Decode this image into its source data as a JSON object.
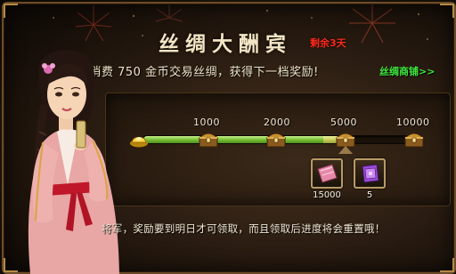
{
  "event": {
    "title": "丝绸大酬宾",
    "days_left": "剩余3天"
  },
  "description": {
    "text": "再消费 750 金币交易丝绸，获得下一档奖励!",
    "shop_link": "丝绸商铺>>"
  },
  "progress": {
    "milestones": [
      "1000",
      "2000",
      "5000",
      "10000"
    ],
    "fill_fraction": 0.72,
    "icons": {
      "start": "gold-ingot-icon",
      "chest": "treasure-chest-icon"
    }
  },
  "rewards": [
    {
      "icon": "silk-cloth-icon",
      "count": "15000"
    },
    {
      "icon": "purple-box-icon",
      "count": "5"
    }
  ],
  "notice": "将军，奖励要到明日才可领取，而且领取后进度将会重置哦！",
  "colors": {
    "title": "#f3e6c5",
    "days_left": "#ff2a1a",
    "shop_link": "#3fe63f",
    "progress_fill": "#7fc53c"
  }
}
